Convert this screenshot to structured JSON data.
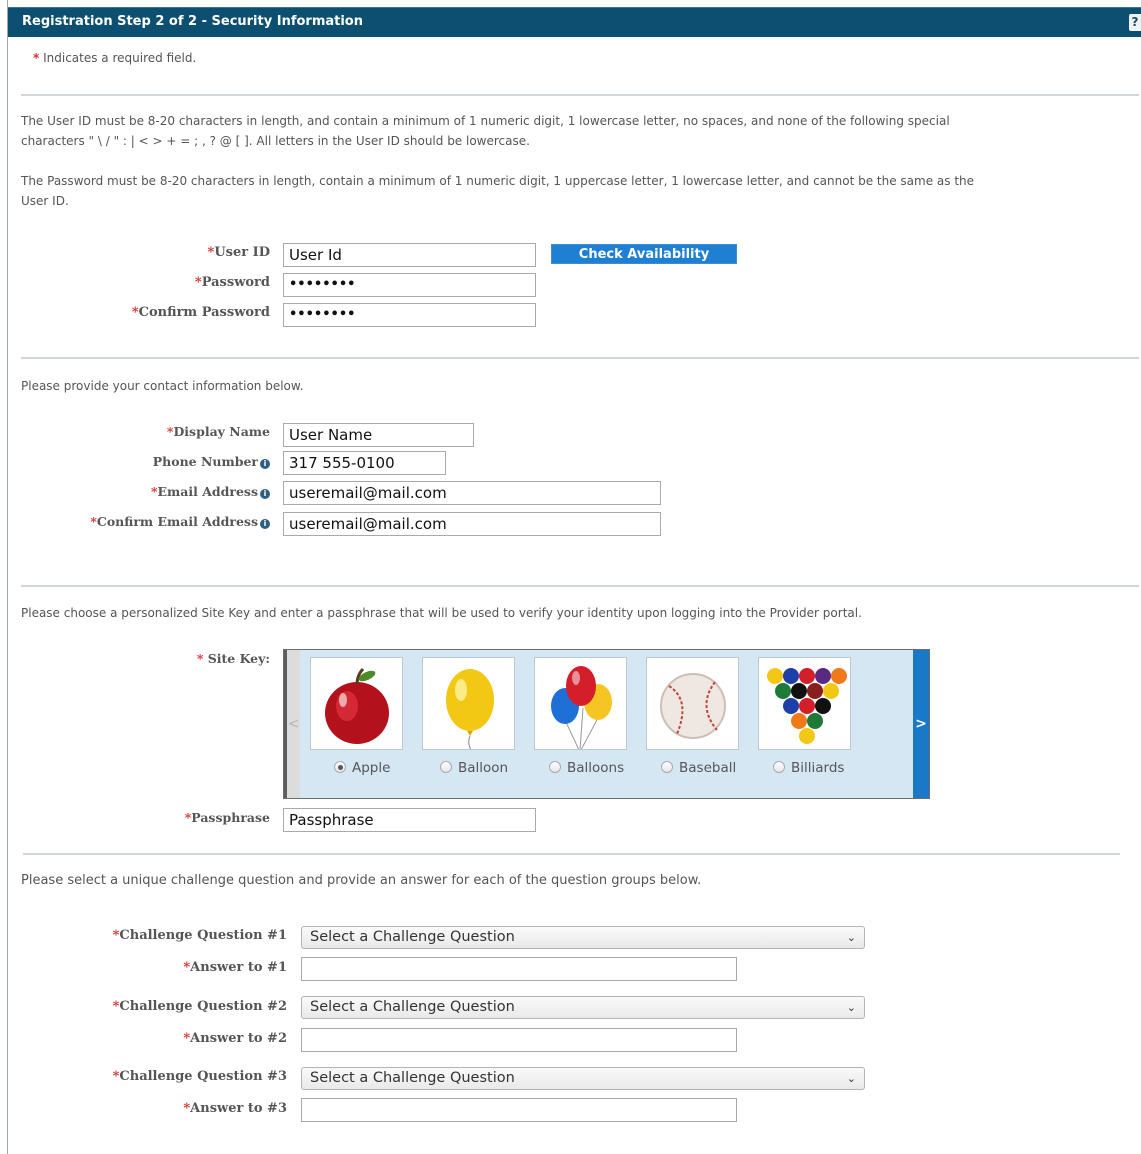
{
  "header": {
    "title": "Registration Step 2 of 2 - Security Information",
    "help_glyph": "?"
  },
  "required_note": "Indicates a required field.",
  "rules": {
    "userid_line1": "The User ID must be 8-20 characters in length, and contain a minimum of 1 numeric digit, 1 lowercase letter, no spaces, and none of the following special",
    "userid_line2": "characters \" \\ / \" : | < > + = ; , ? @ [ ].  All letters in the User ID should be lowercase.",
    "password_line1": "The Password must be 8-20 characters in length, contain a minimum of 1 numeric digit, 1 uppercase letter, 1 lowercase letter, and cannot be the same as the",
    "password_line2": "User ID."
  },
  "account": {
    "userid_label": "User ID",
    "userid_value": "User Id",
    "check_button": "Check Availability",
    "password_label": "Password",
    "password_value": "••••••••",
    "confirm_password_label": "Confirm Password",
    "confirm_password_value": "••••••••"
  },
  "contact": {
    "intro": "Please provide your contact information below.",
    "display_name_label": "Display Name",
    "display_name_value": "User Name",
    "phone_label": "Phone Number",
    "phone_value": "317 555-0100",
    "email_label": "Email Address",
    "email_value": "useremail@mail.com",
    "confirm_email_label": "Confirm Email Address",
    "confirm_email_value": "useremail@mail.com"
  },
  "sitekey": {
    "intro": "Please choose a personalized Site Key and enter a passphrase that will be used to verify your identity upon logging into the Provider portal.",
    "label": "Site Key:",
    "prev_glyph": "<",
    "next_glyph": ">",
    "options": [
      {
        "label": "Apple",
        "icon": "apple-icon",
        "selected": true
      },
      {
        "label": "Balloon",
        "icon": "balloon-icon",
        "selected": false
      },
      {
        "label": "Balloons",
        "icon": "balloons-icon",
        "selected": false
      },
      {
        "label": "Baseball",
        "icon": "baseball-icon",
        "selected": false
      },
      {
        "label": "Billiards",
        "icon": "billiards-icon",
        "selected": false
      }
    ],
    "passphrase_label": "Passphrase",
    "passphrase_value": "Passphrase"
  },
  "challenge": {
    "intro": "Please select a unique challenge question and provide an answer for each of the question groups below.",
    "q1_label": "Challenge Question #1",
    "q1_value": "Select a Challenge Question",
    "a1_label": "Answer to #1",
    "a1_value": "",
    "q2_label": "Challenge Question #2",
    "q2_value": "Select a Challenge Question",
    "a2_label": "Answer to #2",
    "a2_value": "",
    "q3_label": "Challenge Question #3",
    "q3_value": "Select a Challenge Question",
    "a3_label": "Answer to #3",
    "a3_value": ""
  },
  "colors": {
    "header_bg": "#0c4f70",
    "button_bg": "#1e7fd3",
    "required_star": "#d9302c",
    "sitekey_bg": "#d6e7f4"
  }
}
